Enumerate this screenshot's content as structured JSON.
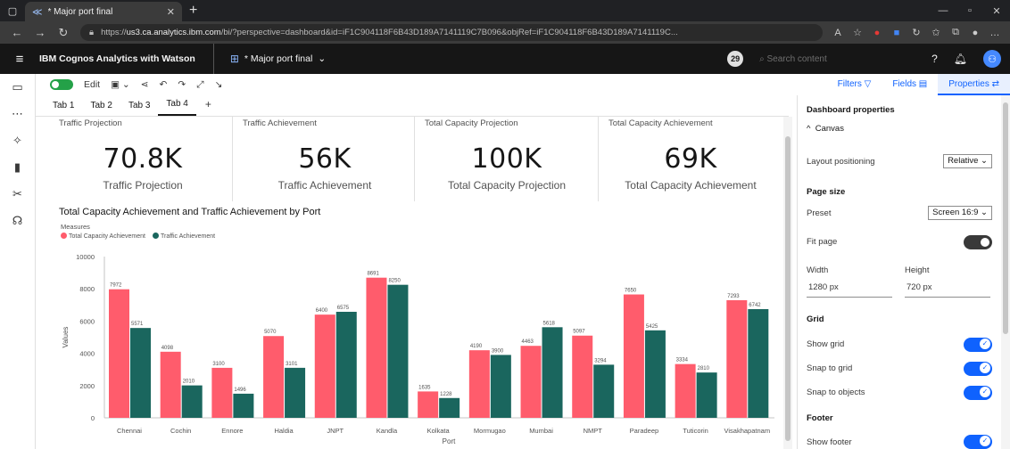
{
  "browser": {
    "tab_title": "* Major port final",
    "url_prefix": "https://",
    "url_host": "us3.ca.analytics.ibm.com",
    "url_rest": "/bi/?perspective=dashboard&id=iF1C904118F6B43D189A7141119C7B096&objRef=iF1C904118F6B43D189A7141119C...",
    "new_tab": "+"
  },
  "app": {
    "brand": "IBM Cognos Analytics with Watson",
    "dashboard_name": "* Major port final",
    "notif_count": "29",
    "search_placeholder": "Search content"
  },
  "toolbar": {
    "edit_label": "Edit",
    "filters_label": "Filters",
    "fields_label": "Fields",
    "properties_label": "Properties"
  },
  "tabs": [
    {
      "label": "Tab 1"
    },
    {
      "label": "Tab 2"
    },
    {
      "label": "Tab 3"
    },
    {
      "label": "Tab 4"
    }
  ],
  "kpis": [
    {
      "header": "Traffic Projection",
      "value": "70.8K",
      "label": "Traffic Projection"
    },
    {
      "header": "Traffic Achievement",
      "value": "56K",
      "label": "Traffic Achievement"
    },
    {
      "header": "Total Capacity Projection",
      "value": "100K",
      "label": "Total Capacity Projection"
    },
    {
      "header": "Total Capacity Achievement",
      "value": "69K",
      "label": "Total Capacity Achievement"
    }
  ],
  "chart_data": {
    "type": "bar",
    "title": "Total Capacity Achievement and Traffic Achievement by Port",
    "legend_title": "Measures",
    "legend_position": "top-left",
    "xlabel": "Port",
    "ylabel": "Values",
    "ylim": [
      0,
      10000
    ],
    "yticks": [
      0,
      2000,
      4000,
      6000,
      8000,
      10000
    ],
    "grid": false,
    "categories": [
      "Chennai",
      "Cochin",
      "Ennore",
      "Haldia",
      "JNPT",
      "Kandla",
      "Kolkata",
      "Mormugao",
      "Mumbai",
      "NMPT",
      "Paradeep",
      "Tuticorin",
      "Visakhapatnam"
    ],
    "series": [
      {
        "name": "Total Capacity Achievement",
        "color": "#ff5c6c",
        "values": [
          7972,
          4098,
          3100,
          5070,
          6400,
          8691,
          1635,
          4190,
          4463,
          5097,
          7650,
          3334,
          7293
        ]
      },
      {
        "name": "Traffic Achievement",
        "color": "#1a665e",
        "values": [
          5571,
          2010,
          1496,
          3101,
          6575,
          8250,
          1228,
          3900,
          5618,
          3294,
          5425,
          2810,
          6742
        ]
      }
    ]
  },
  "properties": {
    "header": "Dashboard properties",
    "canvas_label": "Canvas",
    "layout_positioning_label": "Layout positioning",
    "layout_positioning_value": "Relative",
    "page_size_label": "Page size",
    "preset_label": "Preset",
    "preset_value": "Screen 16:9",
    "fit_page_label": "Fit page",
    "width_label": "Width",
    "width_value": "1280 px",
    "height_label": "Height",
    "height_value": "720 px",
    "grid_label": "Grid",
    "show_grid_label": "Show grid",
    "snap_grid_label": "Snap to grid",
    "snap_objects_label": "Snap to objects",
    "footer_label": "Footer",
    "show_footer_label": "Show footer"
  }
}
